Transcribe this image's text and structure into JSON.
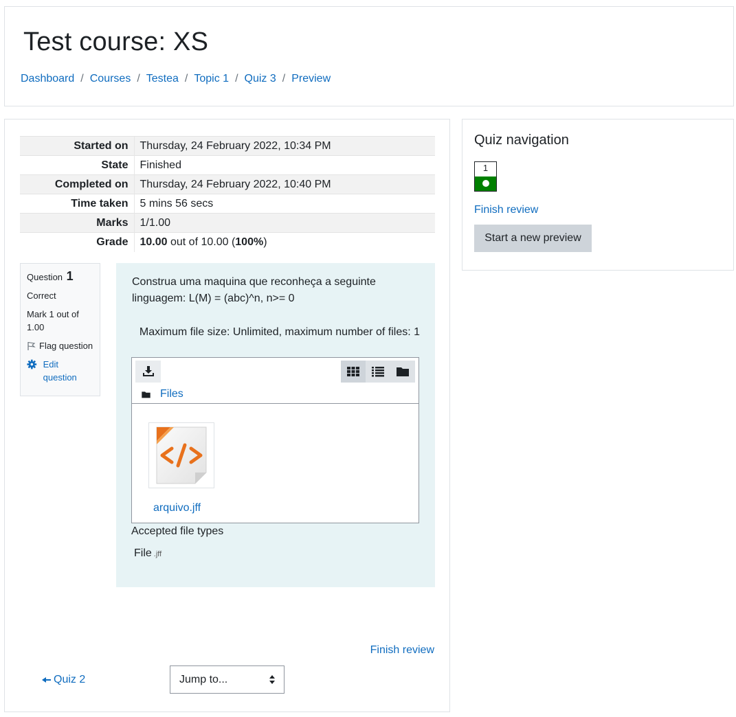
{
  "header": {
    "course_title": "Test course: XS",
    "breadcrumb": [
      "Dashboard",
      "Courses",
      "Testea",
      "Topic 1",
      "Quiz 3",
      "Preview"
    ]
  },
  "summary": [
    {
      "label": "Started on",
      "value": "Thursday, 24 February 2022, 10:34 PM"
    },
    {
      "label": "State",
      "value": "Finished"
    },
    {
      "label": "Completed on",
      "value": "Thursday, 24 February 2022, 10:40 PM"
    },
    {
      "label": "Time taken",
      "value": "5 mins 56 secs"
    },
    {
      "label": "Marks",
      "value": "1/1.00"
    },
    {
      "label": "Grade",
      "grade_value": "10.00",
      "grade_mid": " out of 10.00 (",
      "grade_pct": "100%",
      "grade_end": ")"
    }
  ],
  "question_info": {
    "question_label": "Question",
    "question_number": "1",
    "status": "Correct",
    "mark": "Mark 1 out of 1.00",
    "flag_label": "Flag question",
    "edit_label": "Edit question"
  },
  "question": {
    "text": "Construa uma maquina que reconheça a seguinte linguagem: L(M) = (abc)^n, n>= 0",
    "max_size_text": "Maximum file size: Unlimited, maximum number of files: 1",
    "path_label": "Files",
    "file_name": "arquivo.jff",
    "accepted_title": "Accepted file types",
    "filetype_label": "File",
    "filetype_ext": ".jff"
  },
  "footer": {
    "finish_review": "Finish review",
    "prev_link": "Quiz 2",
    "jump_placeholder": "Jump to..."
  },
  "nav": {
    "title": "Quiz navigation",
    "question_button": "1",
    "finish_review": "Finish review",
    "start_new_preview": "Start a new preview"
  },
  "colors": {
    "link": "#0f6cbf",
    "correct": "#008000",
    "question_bg": "#e7f3f5",
    "file_icon_accent": "#e8711c"
  }
}
